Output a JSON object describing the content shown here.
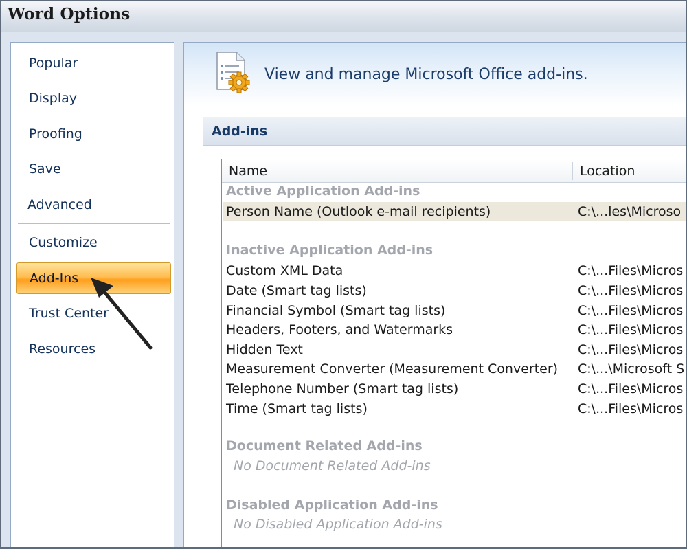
{
  "window": {
    "title": "Word Options"
  },
  "sidebar": {
    "items": [
      {
        "label": "Popular"
      },
      {
        "label": "Display"
      },
      {
        "label": "Proofing"
      },
      {
        "label": "Save"
      },
      {
        "label": "Advanced"
      },
      {
        "label": "Customize"
      },
      {
        "label": "Add-Ins",
        "selected": true
      },
      {
        "label": "Trust Center"
      },
      {
        "label": "Resources"
      }
    ]
  },
  "content": {
    "header_text": "View and manage Microsoft Office add-ins.",
    "header_icon": "addins-gear-icon",
    "section_title": "Add-ins",
    "table": {
      "columns": [
        "Name",
        "Location"
      ],
      "groups": [
        {
          "title": "Active Application Add-ins",
          "rows": [
            {
              "name": "Person Name (Outlook e-mail recipients)",
              "location": "C:\\...les\\Microso",
              "highlighted": true
            }
          ]
        },
        {
          "title": "Inactive Application Add-ins",
          "rows": [
            {
              "name": "Custom XML Data",
              "location": "C:\\...Files\\Micros"
            },
            {
              "name": "Date (Smart tag lists)",
              "location": "C:\\...Files\\Micros"
            },
            {
              "name": "Financial Symbol (Smart tag lists)",
              "location": "C:\\...Files\\Micros"
            },
            {
              "name": "Headers, Footers, and Watermarks",
              "location": "C:\\...Files\\Micros"
            },
            {
              "name": "Hidden Text",
              "location": "C:\\...Files\\Micros"
            },
            {
              "name": "Measurement Converter (Measurement Converter)",
              "location": "C:\\...\\Microsoft S"
            },
            {
              "name": "Telephone Number (Smart tag lists)",
              "location": "C:\\...Files\\Micros"
            },
            {
              "name": "Time (Smart tag lists)",
              "location": "C:\\...Files\\Micros"
            }
          ]
        },
        {
          "title": "Document Related Add-ins",
          "empty_text": "No Document Related Add-ins"
        },
        {
          "title": "Disabled Application Add-ins",
          "empty_text": "No Disabled Application Add-ins"
        }
      ]
    }
  },
  "annotation": {
    "icon": "pointer-arrow-icon",
    "color": "#222222"
  },
  "colors": {
    "selected_nav_gradient_top": "#ffe39a",
    "selected_nav_gradient_mid": "#ff9e1b",
    "nav_text": "#15325b",
    "header_text": "#1c3d6a",
    "group_text": "#a3a7ad",
    "row_highlight": "#ece8dc"
  }
}
